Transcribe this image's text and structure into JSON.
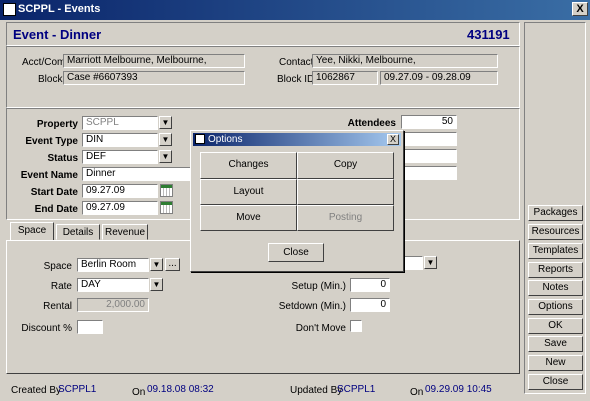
{
  "window": {
    "title": "SCPPL - Events",
    "close_glyph": "X"
  },
  "header": {
    "title": "Event - Dinner",
    "event_id": "431191"
  },
  "account": {
    "acct_label": "Acct/Com",
    "acct_value": "Marriott Melbourne, Melbourne,",
    "contact_label": "Contact",
    "contact_value": "Yee, Nikki, Melbourne,",
    "block_label": "Block",
    "block_value": "Case #6607393",
    "block_id_label": "Block ID",
    "block_id_value": "1062867",
    "block_dates": "09.27.09 - 09.28.09"
  },
  "details": {
    "property_label": "Property",
    "property_value": "SCPPL",
    "event_type_label": "Event Type",
    "event_type_value": "DIN",
    "status_label": "Status",
    "status_value": "DEF",
    "event_name_label": "Event Name",
    "event_name_value": "Dinner",
    "start_date_label": "Start Date",
    "start_date_value": "09.27.09",
    "end_date_label": "End Date",
    "end_date_value": "09.27.09",
    "attendees_label": "Attendees",
    "attendees_value": "50"
  },
  "tabs": [
    "Space",
    "Details",
    "Revenue"
  ],
  "space": {
    "space_label": "Space",
    "space_value": "Berlin Room",
    "ellipsis": "...",
    "rate_label": "Rate",
    "rate_value": "DAY",
    "rental_label": "Rental",
    "rental_value": "2,000.00",
    "discount_label": "Discount %",
    "discount_value": "",
    "setup_label": "Setup (Min.)",
    "setup_value": "0",
    "setdown_label": "Setdown (Min.)",
    "setdown_value": "0",
    "dont_move_label": "Don't Move"
  },
  "footer": {
    "created_by_label": "Created By",
    "created_by_value": "SCPPL1",
    "on_label": "On",
    "created_on_value": "09.18.08 08:32",
    "updated_by_label": "Updated By",
    "updated_by_value": "SCPPL1",
    "updated_on_value": "09.29.09 10:45"
  },
  "sidebar": [
    "Packages",
    "Resources",
    "Templates",
    "Reports",
    "Notes",
    "Options",
    "OK",
    "Save",
    "New",
    "Close"
  ],
  "dialog": {
    "title": "Options",
    "close_glyph": "X",
    "buttons": [
      "Changes",
      "Copy",
      "Layout",
      "",
      "Move",
      "Posting"
    ],
    "close_label": "Close"
  }
}
